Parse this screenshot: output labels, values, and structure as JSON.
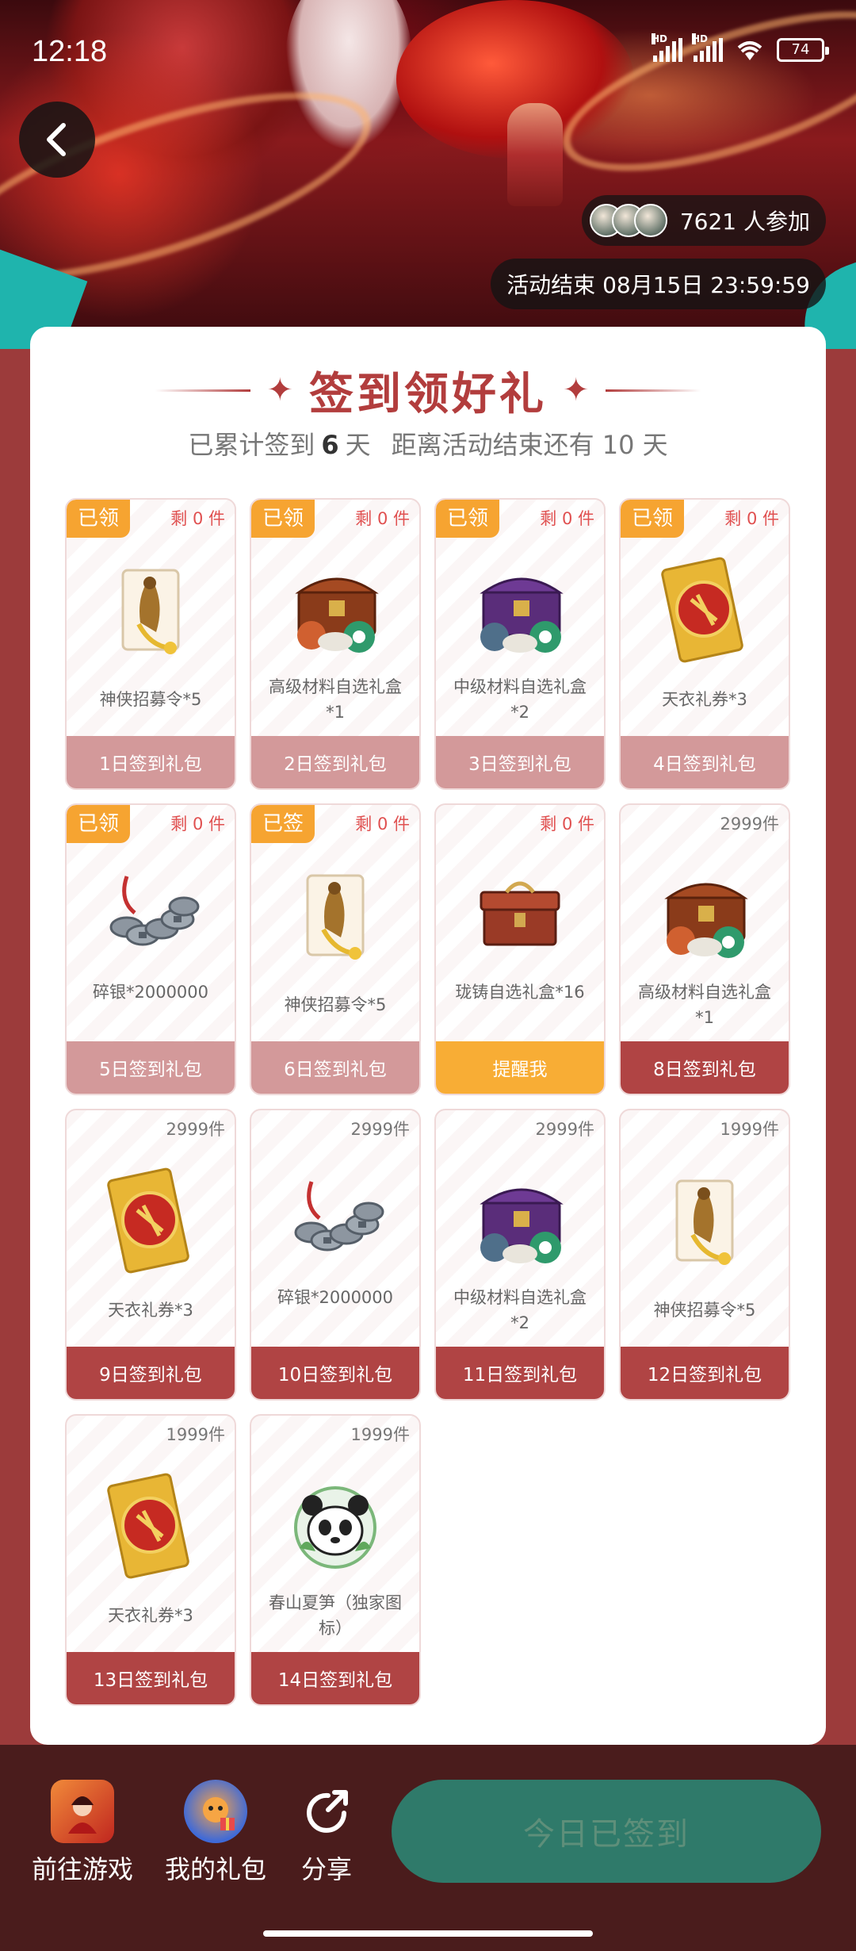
{
  "status_bar": {
    "time": "12:18",
    "battery": "74"
  },
  "hero": {
    "participants": "7621 人参加",
    "end_time": "活动结束 08月15日 23:59:59"
  },
  "header": {
    "title": "签到领好礼",
    "subtitle_prefix": "已累计签到",
    "days_signed": "6",
    "subtitle_unit": "天",
    "subtitle_remaining": "距离活动结束还有 10 天"
  },
  "tiles": [
    {
      "badge": "已领",
      "stock": "剩 0 件",
      "name": "神侠招募令*5",
      "button": "1日签到礼包",
      "art": "scroll-icon"
    },
    {
      "badge": "已领",
      "stock": "剩 0 件",
      "name": "高级材料自选礼盒*1",
      "button": "2日签到礼包",
      "art": "chest-icon"
    },
    {
      "badge": "已领",
      "stock": "剩 0 件",
      "name": "中级材料自选礼盒*2",
      "button": "3日签到礼包",
      "art": "purple-chest-icon"
    },
    {
      "badge": "已领",
      "stock": "剩 0 件",
      "name": "天衣礼券*3",
      "button": "4日签到礼包",
      "art": "ticket-icon"
    },
    {
      "badge": "已领",
      "stock": "剩 0 件",
      "name": "碎银*2000000",
      "button": "5日签到礼包",
      "art": "coins-icon"
    },
    {
      "badge": "已签",
      "stock": "剩 0 件",
      "name": "神侠招募令*5",
      "button": "6日签到礼包",
      "art": "scroll-icon"
    },
    {
      "badge": "",
      "stock": "剩 0 件",
      "name": "珑铸自选礼盒*16",
      "button": "提醒我",
      "art": "box-icon"
    },
    {
      "badge": "",
      "stock": "2999件",
      "name": "高级材料自选礼盒*1",
      "button": "8日签到礼包",
      "art": "chest-icon"
    },
    {
      "badge": "",
      "stock": "2999件",
      "name": "天衣礼券*3",
      "button": "9日签到礼包",
      "art": "ticket-icon"
    },
    {
      "badge": "",
      "stock": "2999件",
      "name": "碎银*2000000",
      "button": "10日签到礼包",
      "art": "coins-icon"
    },
    {
      "badge": "",
      "stock": "2999件",
      "name": "中级材料自选礼盒*2",
      "button": "11日签到礼包",
      "art": "purple-chest-icon"
    },
    {
      "badge": "",
      "stock": "1999件",
      "name": "神侠招募令*5",
      "button": "12日签到礼包",
      "art": "scroll-icon"
    },
    {
      "badge": "",
      "stock": "1999件",
      "name": "天衣礼券*3",
      "button": "13日签到礼包",
      "art": "ticket-icon"
    },
    {
      "badge": "",
      "stock": "1999件",
      "name": "春山夏笋（独家图标）",
      "button": "14日签到礼包",
      "art": "panda-icon"
    }
  ],
  "bottom_bar": {
    "go_game": "前往游戏",
    "my_gifts": "我的礼包",
    "share": "分享",
    "checkin": "今日已签到"
  },
  "colors": {
    "accent": "#b23d3d",
    "badge": "#f6a431",
    "claimed_button": "#d3999a",
    "active_button": "#b04444",
    "remind_button": "#f8ad35",
    "checkin_button": "#2f7a6a"
  }
}
